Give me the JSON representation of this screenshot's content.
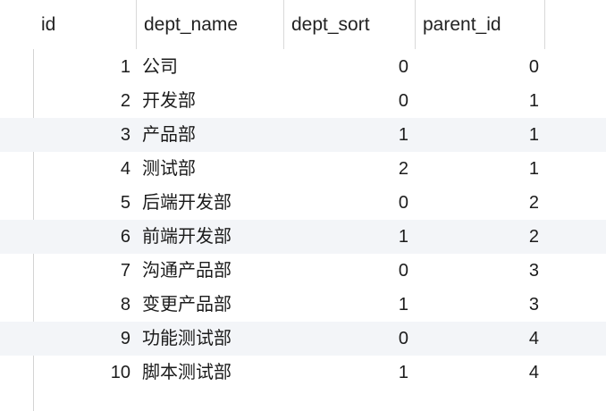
{
  "columns": {
    "id": "id",
    "dept_name": "dept_name",
    "dept_sort": "dept_sort",
    "parent_id": "parent_id"
  },
  "rows": [
    {
      "id": "1",
      "dept_name": "公司",
      "dept_sort": "0",
      "parent_id": "0"
    },
    {
      "id": "2",
      "dept_name": "开发部",
      "dept_sort": "0",
      "parent_id": "1"
    },
    {
      "id": "3",
      "dept_name": "产品部",
      "dept_sort": "1",
      "parent_id": "1"
    },
    {
      "id": "4",
      "dept_name": "测试部",
      "dept_sort": "2",
      "parent_id": "1"
    },
    {
      "id": "5",
      "dept_name": "后端开发部",
      "dept_sort": "0",
      "parent_id": "2"
    },
    {
      "id": "6",
      "dept_name": "前端开发部",
      "dept_sort": "1",
      "parent_id": "2"
    },
    {
      "id": "7",
      "dept_name": "沟通产品部",
      "dept_sort": "0",
      "parent_id": "3"
    },
    {
      "id": "8",
      "dept_name": "变更产品部",
      "dept_sort": "1",
      "parent_id": "3"
    },
    {
      "id": "9",
      "dept_name": "功能测试部",
      "dept_sort": "0",
      "parent_id": "4"
    },
    {
      "id": "10",
      "dept_name": "脚本测试部",
      "dept_sort": "1",
      "parent_id": "4"
    }
  ]
}
